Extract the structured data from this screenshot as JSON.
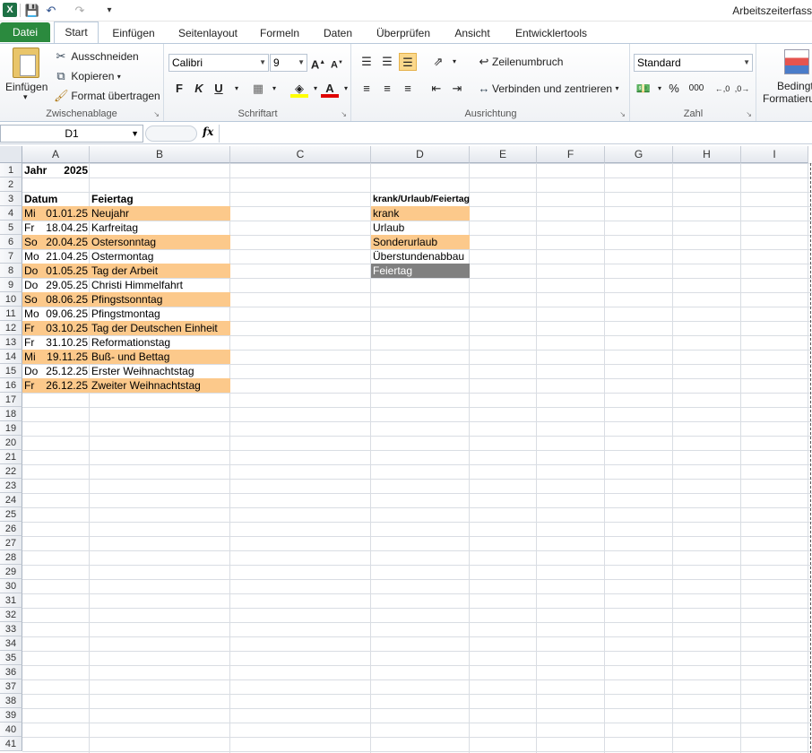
{
  "window": {
    "title": "Arbeitszeiterfass"
  },
  "qat": {
    "save_icon": "save-icon",
    "undo_icon": "undo-icon",
    "redo_icon": "redo-icon"
  },
  "tabs": [
    {
      "label": "Datei"
    },
    {
      "label": "Start"
    },
    {
      "label": "Einfügen"
    },
    {
      "label": "Seitenlayout"
    },
    {
      "label": "Formeln"
    },
    {
      "label": "Daten"
    },
    {
      "label": "Überprüfen"
    },
    {
      "label": "Ansicht"
    },
    {
      "label": "Entwicklertools"
    }
  ],
  "ribbon": {
    "clipboard": {
      "label": "Zwischenablage",
      "paste": "Einfügen",
      "cut": "Ausschneiden",
      "copy": "Kopieren",
      "format_painter": "Format übertragen"
    },
    "font": {
      "label": "Schriftart",
      "name": "Calibri",
      "size": "9",
      "bold": "F",
      "italic": "K",
      "underline": "U"
    },
    "alignment": {
      "label": "Ausrichtung",
      "wrap": "Zeilenumbruch",
      "merge": "Verbinden und zentrieren"
    },
    "number": {
      "label": "Zahl",
      "format": "Standard",
      "percent": "%",
      "thousands": "000"
    },
    "styles": {
      "label1": "Bedingt",
      "label2": "Formatieru"
    }
  },
  "formula_bar": {
    "name_box": "D1",
    "fx": "fx",
    "value": ""
  },
  "columns": [
    "A",
    "B",
    "C",
    "D",
    "E",
    "F",
    "G",
    "H",
    "I"
  ],
  "rows_count": 41,
  "cells": {
    "A1": "Jahr",
    "A1b": "2025",
    "A3": "Datum",
    "B3": "Feiertag",
    "D3": "krank/Urlaub/Feiertag",
    "holidays": [
      {
        "day": "Mi",
        "date": "01.01.25",
        "name": "Neujahr",
        "hl": true
      },
      {
        "day": "Fr",
        "date": "18.04.25",
        "name": "Karfreitag",
        "hl": false
      },
      {
        "day": "So",
        "date": "20.04.25",
        "name": "Ostersonntag",
        "hl": true
      },
      {
        "day": "Mo",
        "date": "21.04.25",
        "name": "Ostermontag",
        "hl": false
      },
      {
        "day": "Do",
        "date": "01.05.25",
        "name": "Tag der Arbeit",
        "hl": true
      },
      {
        "day": "Do",
        "date": "29.05.25",
        "name": "Christi Himmelfahrt",
        "hl": false
      },
      {
        "day": "So",
        "date": "08.06.25",
        "name": "Pfingstsonntag",
        "hl": true
      },
      {
        "day": "Mo",
        "date": "09.06.25",
        "name": "Pfingstmontag",
        "hl": false
      },
      {
        "day": "Fr",
        "date": "03.10.25",
        "name": "Tag der Deutschen Einheit",
        "hl": true
      },
      {
        "day": "Fr",
        "date": "31.10.25",
        "name": "Reformationstag",
        "hl": false
      },
      {
        "day": "Mi",
        "date": "19.11.25",
        "name": "Buß- und Bettag",
        "hl": true
      },
      {
        "day": "Do",
        "date": "25.12.25",
        "name": "Erster Weihnachtstag",
        "hl": false
      },
      {
        "day": "Fr",
        "date": "26.12.25",
        "name": "Zweiter Weihnachtstag",
        "hl": true
      }
    ],
    "legend": [
      {
        "label": "krank",
        "style": "hl"
      },
      {
        "label": "Urlaub",
        "style": ""
      },
      {
        "label": "Sonderurlaub",
        "style": "hl"
      },
      {
        "label": "Überstundenabbau",
        "style": ""
      },
      {
        "label": "Feiertag",
        "style": "dark"
      }
    ]
  },
  "colors": {
    "highlight": "#fcc98b",
    "dark": "#808080",
    "file_tab": "#2b8a3e"
  }
}
